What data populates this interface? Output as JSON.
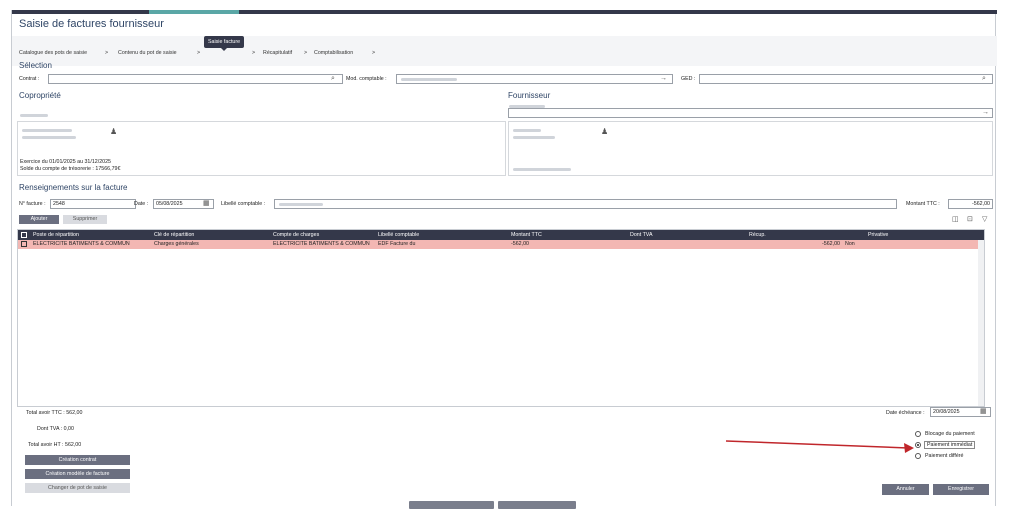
{
  "app": {
    "title": "Saisie de factures fournisseur"
  },
  "breadcrumb": {
    "step1": "Catalogue des pots de saisie",
    "step2": "Contenu du pot de saisie",
    "step3": "Saisie facture",
    "step4": "Récapitulatif",
    "step5": "Comptabilisation",
    "sep": ">"
  },
  "selection": {
    "title": "Sélection",
    "contrat_label": "Contrat :",
    "mod_label": "Mod. comptable :",
    "ged_label": "GED :"
  },
  "copro": {
    "title": "Copropriété",
    "exercice": "Exercice du 01/01/2025 au 31/12/2025",
    "solde": "Solde du compte de trésorerie : 17566,79€"
  },
  "fournisseur": {
    "title": "Fournisseur"
  },
  "facture": {
    "title": "Renseignements sur la facture",
    "num_label": "N° facture :",
    "num_value": "2548",
    "date_label": "Date :",
    "date_value": "05/08/2025",
    "libelle_label": "Libellé comptable :",
    "montant_label": "Montant TTC :",
    "montant_value": "-562,00",
    "add_label": "Ajouter",
    "del_label": "Supprimer"
  },
  "grid": {
    "columns": [
      "Poste de répartition",
      "Clé de répartition",
      "Compte de charges",
      "Libellé comptable",
      "Montant TTC",
      "Dont TVA",
      "Récup.",
      "Privative"
    ],
    "rows": [
      {
        "poste": "ELECTRICITE BATIMENTS & COMMUN",
        "cle": "Charges générales",
        "compte": "ELECTRICITE BATIMENTS & COMMUN",
        "libelle": "EDF Facture du",
        "montant": "-562,00",
        "tva": "",
        "recup": "-562,00",
        "privative": "Non"
      }
    ]
  },
  "totals": {
    "avoir_ttc": "Total avoir TTC : 562,00",
    "dont_tva": "Dont TVA : 0,00",
    "avoir_ht": "Total avoir HT : 562,00"
  },
  "actions": {
    "creation_contrat": "Création contrat",
    "creation_modele": "Création modèle de facture",
    "changer_pot": "Changer de pot de saisie",
    "annuler": "Annuler",
    "enregistrer": "Enregistrer"
  },
  "echeance": {
    "label": "Date échéance :",
    "value": "20/08/2025"
  },
  "paiement": {
    "options": [
      "Blocage du paiement",
      "Paiement immédiat",
      "Paiement différé"
    ],
    "selected": "Paiement immédiat"
  },
  "colors": {
    "header": "#34384a",
    "row_highlight": "#f3b7b3",
    "accent_title": "#2f4566",
    "arrow": "#c0262b"
  },
  "icons": [
    "search-icon",
    "arrow-right-icon",
    "calendar-icon",
    "person-icon",
    "filter-icon",
    "columns-icon",
    "export-icon"
  ]
}
